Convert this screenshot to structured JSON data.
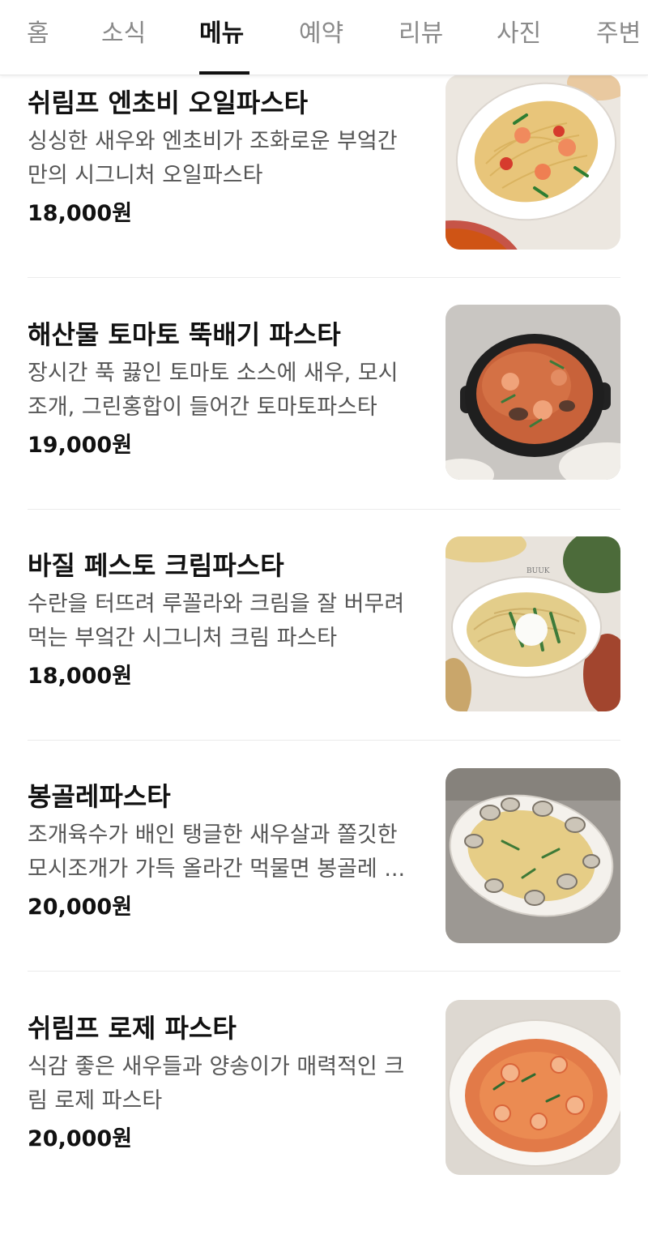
{
  "tabs": [
    {
      "label": "홈",
      "active": false
    },
    {
      "label": "소식",
      "active": false
    },
    {
      "label": "메뉴",
      "active": true
    },
    {
      "label": "예약",
      "active": false
    },
    {
      "label": "리뷰",
      "active": false
    },
    {
      "label": "사진",
      "active": false
    },
    {
      "label": "주변",
      "active": false
    }
  ],
  "menu": {
    "items": [
      {
        "name": "쉬림프 엔초비 오일파스타",
        "desc_lines": [
          "싱싱한 새우와 엔초비가 조화로운 부엌간",
          "만의 시그니처 오일파스타"
        ],
        "price": "18,000원",
        "image": "shrimp-anchovy-oil-pasta-photo"
      },
      {
        "name": "해산물 토마토 뚝배기 파스타",
        "desc_lines": [
          "장시간 푹 끓인 토마토 소스에 새우, 모시",
          "조개, 그린홍합이 들어간 토마토파스타"
        ],
        "price": "19,000원",
        "image": "seafood-tomato-pot-pasta-photo"
      },
      {
        "name": "바질 페스토 크림파스타",
        "desc_lines": [
          "수란을 터뜨려 루꼴라와 크림을 잘 버무려",
          "먹는 부엌간 시그니처 크림 파스타"
        ],
        "price": "18,000원",
        "image": "basil-pesto-cream-pasta-photo"
      },
      {
        "name": "봉골레파스타",
        "desc_lines": [
          "조개육수가 배인 탱글한 새우살과 쫄깃한",
          "모시조개가 가득 올라간 먹물면 봉골레 ..."
        ],
        "price": "20,000원",
        "image": "vongole-pasta-photo"
      },
      {
        "name": "쉬림프 로제 파스타",
        "desc_lines": [
          "식감 좋은 새우들과 양송이가 매력적인 크",
          "림 로제 파스타"
        ],
        "price": "20,000원",
        "image": "shrimp-rose-pasta-photo"
      }
    ]
  },
  "colors": {
    "text_primary": "#111111",
    "text_secondary": "#555555",
    "tab_inactive": "#8a8a8a",
    "divider": "#ebebeb"
  }
}
